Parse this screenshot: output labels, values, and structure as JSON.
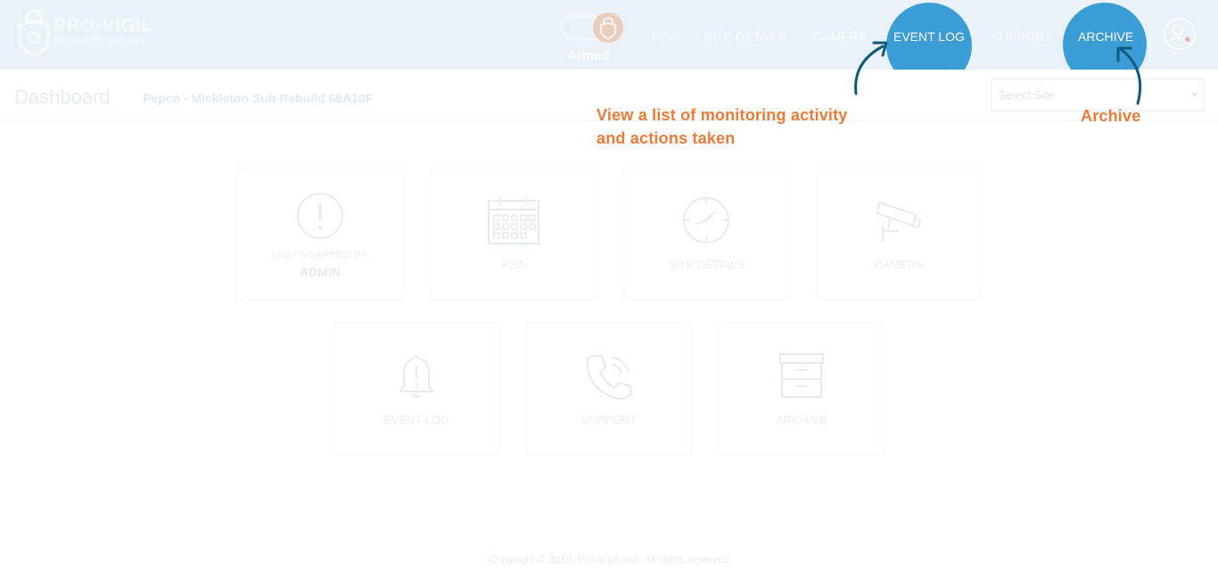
{
  "app": {
    "logo_title": "PRO-VIGIL",
    "logo_subtitle": "Surveillance Services",
    "armed_label": "Armed"
  },
  "nav": {
    "psa": "PSA",
    "site_details": "SITE DETAILS",
    "camera": "CAMERA",
    "event_log": "EVENT LOG",
    "support": "SUPPORT",
    "archive": "ARCHIVE"
  },
  "page": {
    "title": "Dashboard",
    "site_name": "Pepco - Mickleton Sub Rebuild 68A10F",
    "select_placeholder": "Select Site"
  },
  "tooltips": {
    "event_log_line1": "View a list of monitoring activity",
    "event_log_line2": "and actions taken",
    "archive": "Archive"
  },
  "tiles": {
    "last_disarmed_label": "LAST DISARMED BY",
    "last_disarmed_value": "ADMIN",
    "psa": "PSA",
    "site_details": "SITE DETAILS",
    "camera": "CAMERA",
    "event_log": "EVENT LOG",
    "support": "SUPPORT",
    "archive": "ARCHIVE"
  },
  "footer": {
    "copyright": "Copyright © 2019. Pro-Vigil, Inc. All rights reserved"
  },
  "colors": {
    "header_bg": "#e8f2f8",
    "highlight": "#3a9dd6",
    "tooltip_orange": "#ef7a36",
    "arrow_blue": "#0f5a78"
  }
}
